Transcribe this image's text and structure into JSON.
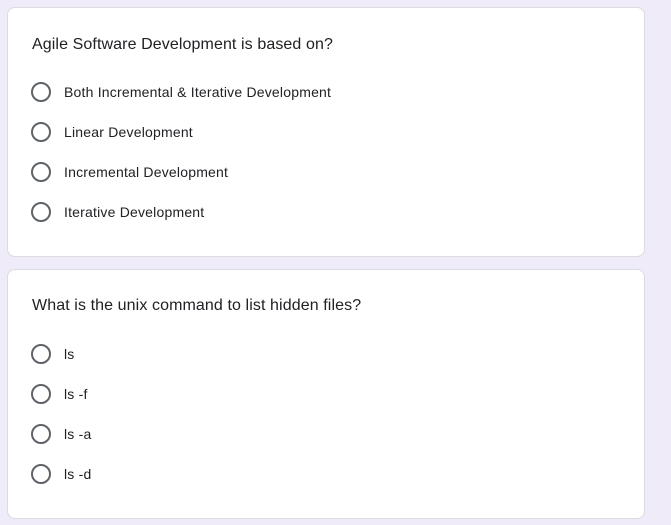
{
  "questions": [
    {
      "title": "Agile Software Development is based on?",
      "options": [
        {
          "label": "Both Incremental & Iterative Development",
          "selected": false
        },
        {
          "label": "Linear Development",
          "selected": false
        },
        {
          "label": "Incremental Development",
          "selected": false
        },
        {
          "label": "Iterative Development",
          "selected": false
        }
      ]
    },
    {
      "title": "What is the unix command to list hidden files?",
      "options": [
        {
          "label": "ls",
          "selected": false
        },
        {
          "label": "ls -f",
          "selected": false
        },
        {
          "label": "ls -a",
          "selected": false
        },
        {
          "label": "ls -d",
          "selected": false
        }
      ]
    }
  ],
  "colors": {
    "page_background": "#f0ebf8",
    "card_background": "#ffffff",
    "card_border": "#dadce0",
    "radio_border": "#5f6368",
    "text": "#202124"
  }
}
